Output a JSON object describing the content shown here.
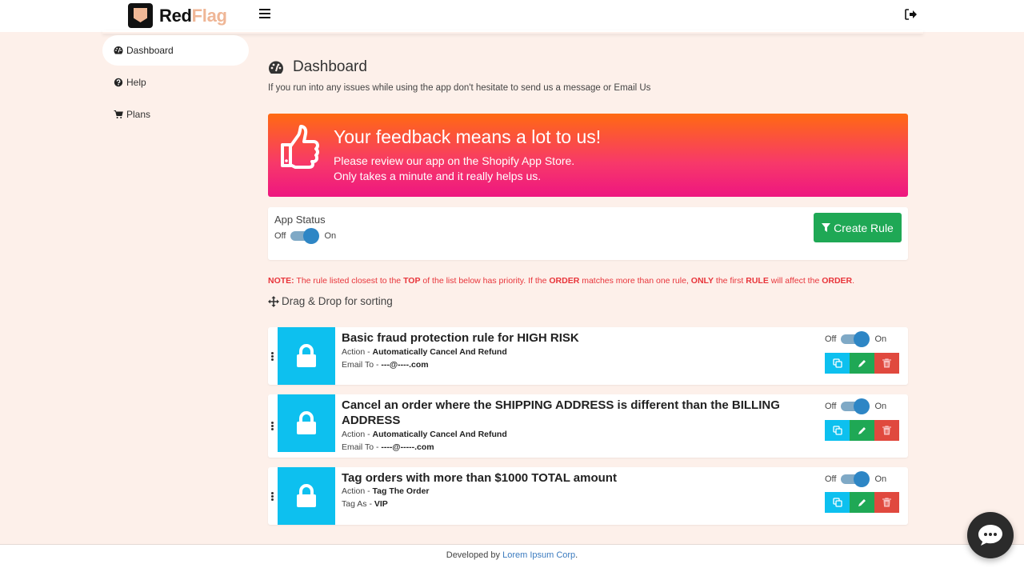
{
  "app": {
    "logo_part1": "Red",
    "logo_part2": "Flag",
    "colors": {
      "accent": "#efb696",
      "banner_top": "#ff6a12",
      "banner_bottom": "#ee1680",
      "toggle": "#2e86c5",
      "green": "#1fa855",
      "cyan": "#0dc0ef",
      "red": "#e0493e",
      "note": "#e8343a"
    }
  },
  "header": {
    "menu_icon": "hamburger-icon",
    "logout_icon": "sign-out-icon"
  },
  "sidebar": {
    "items": [
      {
        "label": "Dashboard",
        "icon": "tachometer-icon",
        "active": true
      },
      {
        "label": "Help",
        "icon": "question-circle-icon",
        "active": false
      },
      {
        "label": "Plans",
        "icon": "shopping-cart-icon",
        "active": false
      }
    ]
  },
  "page": {
    "title": "Dashboard",
    "subtitle": "If you run into any issues while using the app don't hesitate to send us a message or Email Us"
  },
  "banner": {
    "title": "Your feedback means a lot to us!",
    "line1": "Please review our app on the Shopify App Store.",
    "line2": "Only takes a minute and it really helps us.",
    "icon": "thumbs-up-icon"
  },
  "status": {
    "label": "App Status",
    "off_label": "Off",
    "on_label": "On",
    "enabled": true,
    "create_button": "Create Rule"
  },
  "note": {
    "prefix": "NOTE:",
    "t1": " The rule listed closest to the ",
    "b1": "TOP",
    "t2": " of the list below has priority. If the ",
    "b2": "ORDER",
    "t3": " matches more than one rule, ",
    "b3": "ONLY",
    "t4": " the first ",
    "b4": "RULE",
    "t5": " will affect the ",
    "b5": "ORDER",
    "t6": "."
  },
  "drag_label": "Drag & Drop for sorting",
  "rules": [
    {
      "title": "Basic fraud protection rule for HIGH RISK",
      "line1_label": "Action - ",
      "line1_value": "Automatically Cancel And Refund",
      "line2_label": "Email To - ",
      "line2_value": "---@----.com",
      "enabled": true
    },
    {
      "title": "Cancel an order where the SHIPPING ADDRESS is different than the BILLING ADDRESS",
      "line1_label": "Action - ",
      "line1_value": "Automatically Cancel And Refund",
      "line2_label": "Email To - ",
      "line2_value": "----@-----.com",
      "enabled": true
    },
    {
      "title": "Tag orders with more than $1000 TOTAL amount",
      "line1_label": "Action - ",
      "line1_value": "Tag The Order",
      "line2_label": "Tag As - ",
      "line2_value": "VIP",
      "enabled": true
    }
  ],
  "rule_toggle": {
    "off_label": "Off",
    "on_label": "On"
  },
  "footer": {
    "prefix": "Developed by ",
    "link": "Lorem Ipsum Corp",
    "suffix": "."
  }
}
